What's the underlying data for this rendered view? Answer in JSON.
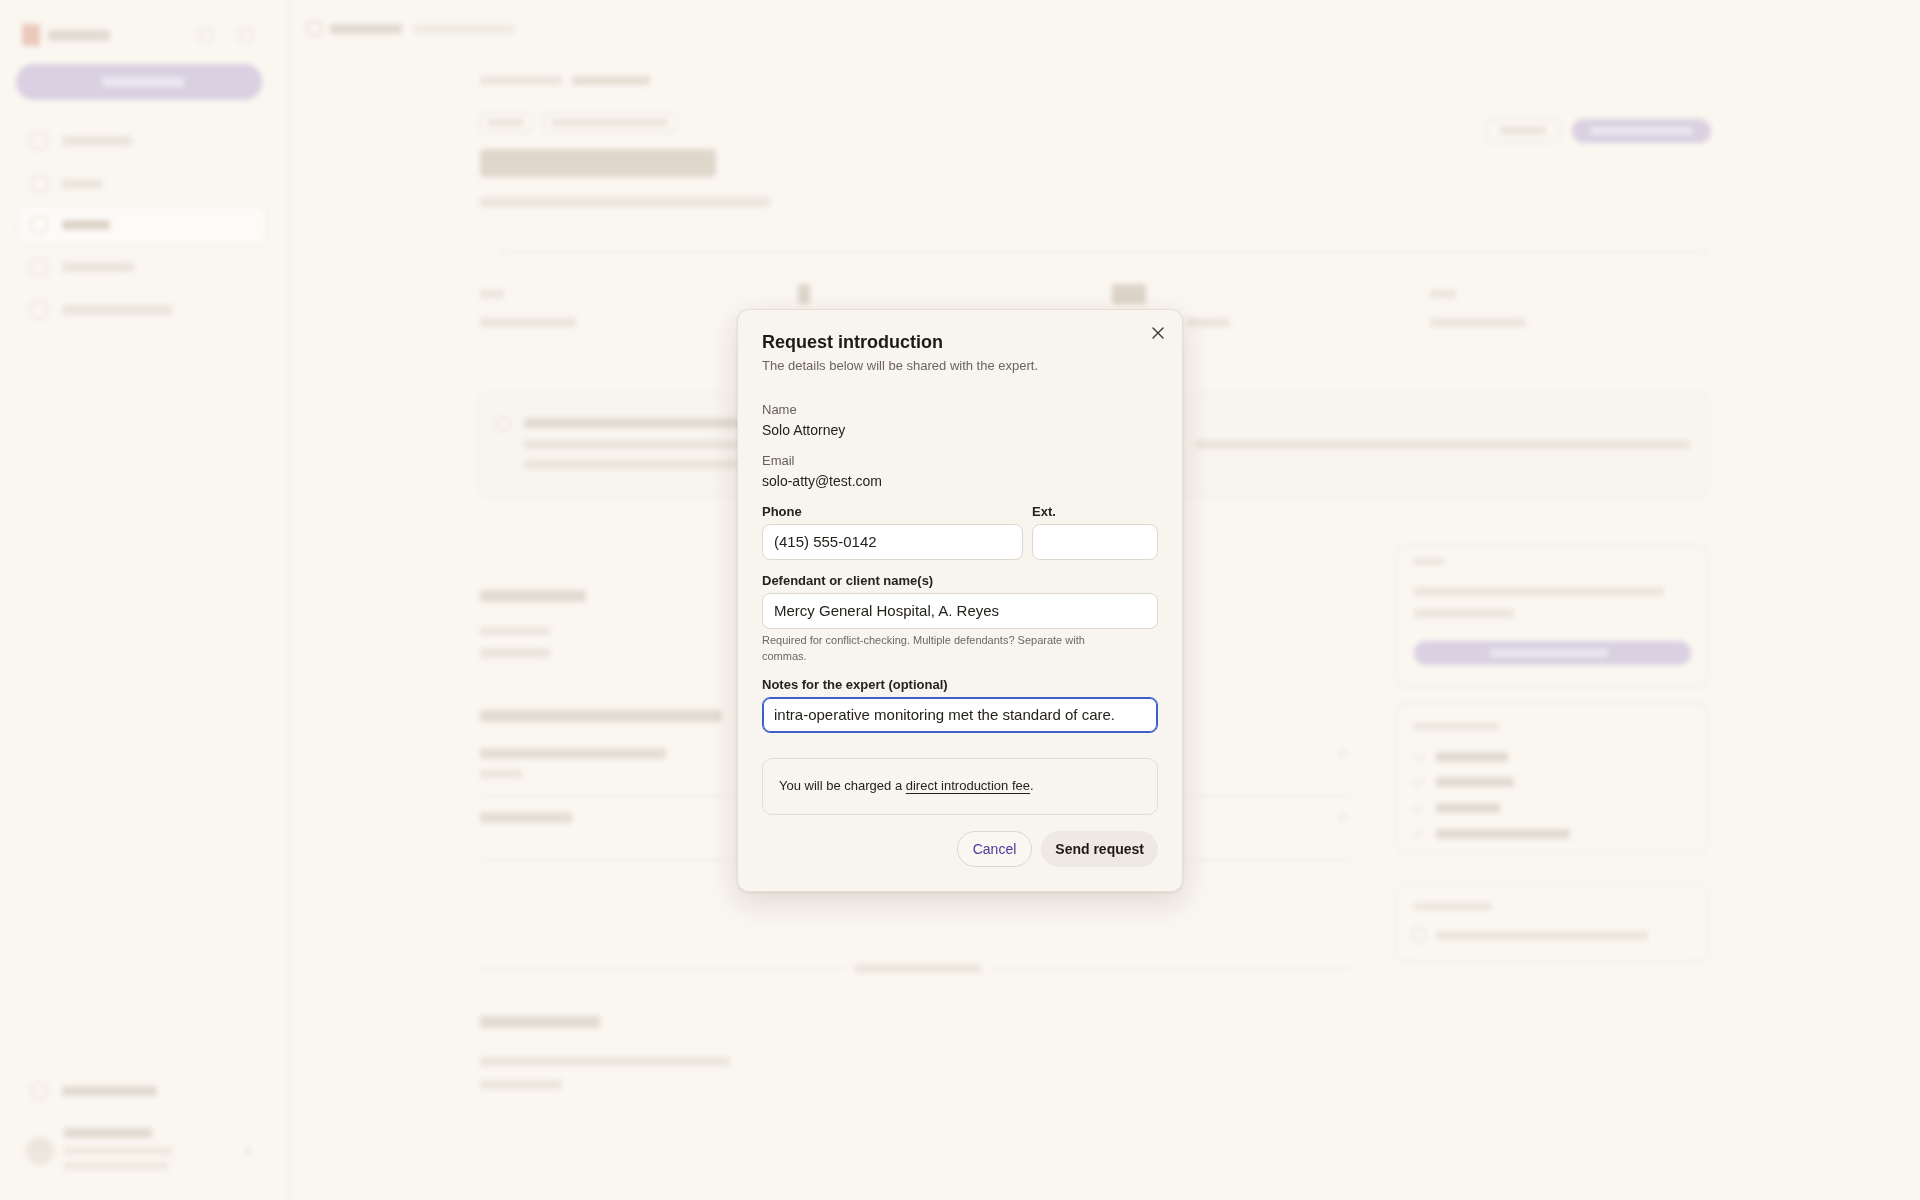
{
  "dialog": {
    "title": "Request introduction",
    "subtitle": "The details below will be shared with the expert.",
    "rows": [
      {
        "fields": [
          {
            "kind": "static",
            "label": "Name",
            "value": "Solo Attorney"
          }
        ]
      },
      {
        "fields": [
          {
            "kind": "static",
            "label": "Email",
            "value": "solo-atty@test.com"
          }
        ]
      },
      {
        "fields": [
          {
            "kind": "input",
            "label": "Phone",
            "value": "(415) 555-0142",
            "focused": false
          },
          {
            "kind": "input",
            "label": "Ext.",
            "focused": false
          }
        ]
      },
      {
        "fields": [
          {
            "kind": "input",
            "label": "Defendant or client name(s)",
            "value": "Mercy General Hospital, A. Reyes",
            "hint": "Required for conflict-checking. Multiple defendants? Separate with commas.",
            "focused": false
          }
        ]
      },
      {
        "fields": [
          {
            "kind": "input",
            "label": "Notes for the expert (optional)",
            "value": "intra-operative monitoring met the standard of care.",
            "focused": true
          }
        ]
      }
    ],
    "notice": {
      "text": "You will be charged a ",
      "link": "direct introduction fee",
      "end": "."
    },
    "buttons": [
      {
        "kind": "secondary",
        "label": "Cancel"
      },
      {
        "kind": "primary",
        "label": "Send request"
      }
    ]
  }
}
